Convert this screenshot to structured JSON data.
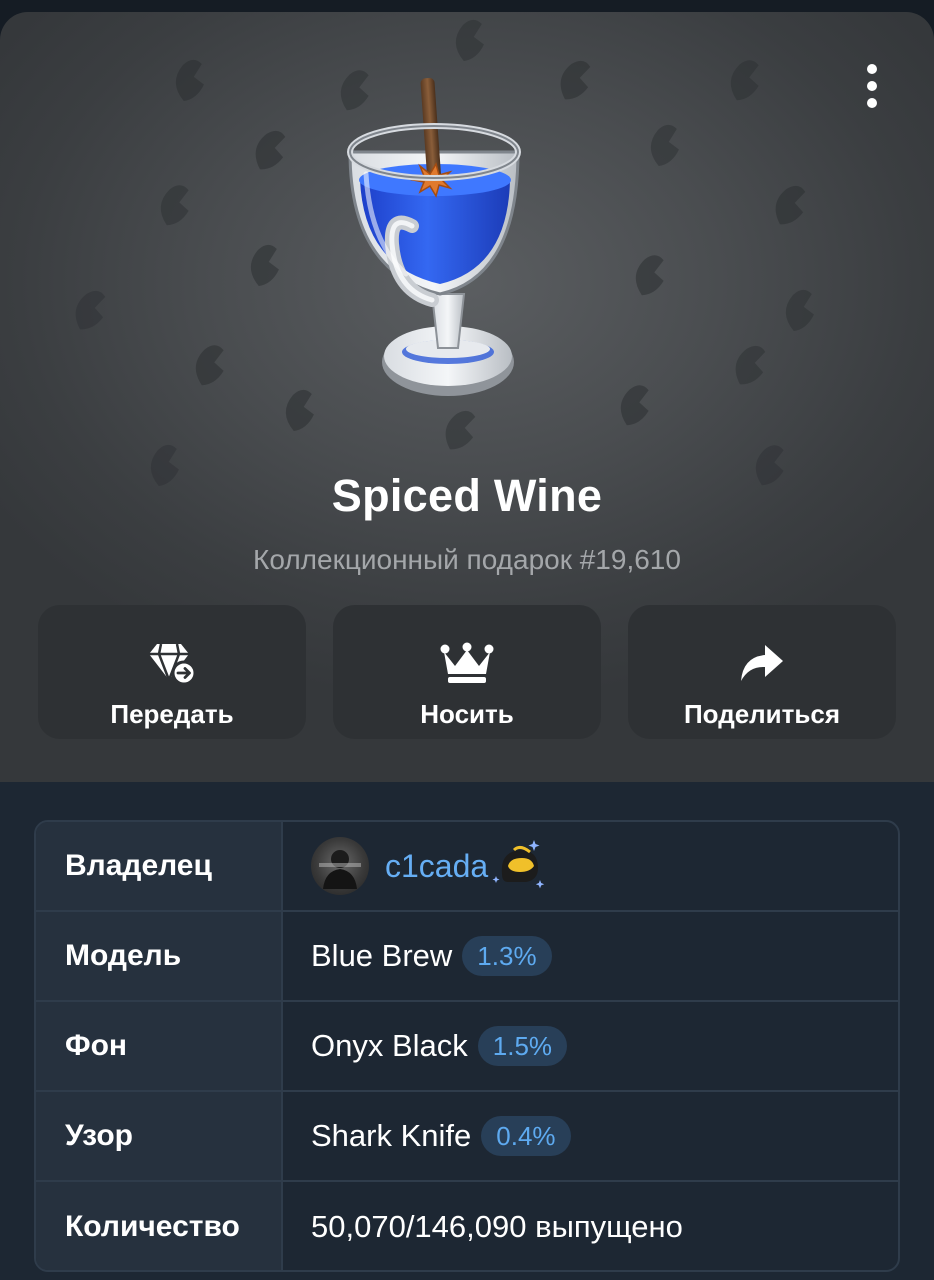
{
  "gift": {
    "title": "Spiced Wine",
    "subtitle": "Коллекционный подарок #19,610"
  },
  "actions": [
    {
      "label": "Передать",
      "icon": "diamond-transfer-icon"
    },
    {
      "label": "Носить",
      "icon": "crown-icon"
    },
    {
      "label": "Поделиться",
      "icon": "share-arrow-icon"
    }
  ],
  "menu": {
    "icon": "more-vertical-icon"
  },
  "details": {
    "owner": {
      "key": "Владелец",
      "name": "c1cada",
      "avatar_icon": "user-avatar",
      "status_icon": "helmet-emoji-status-icon"
    },
    "model": {
      "key": "Модель",
      "value": "Blue Brew",
      "rarity": "1.3%"
    },
    "backdrop": {
      "key": "Фон",
      "value": "Onyx Black",
      "rarity": "1.5%"
    },
    "pattern": {
      "key": "Узор",
      "value": "Shark Knife",
      "rarity": "0.4%"
    },
    "quantity": {
      "key": "Количество",
      "value": "50,070/146,090 выпущено"
    }
  },
  "colors": {
    "page_bg": "#1d2733",
    "hero_bg": "#4a4d50",
    "button_bg": "#2e3134",
    "badge_bg": "#283f58",
    "accent_blue": "#5eaaf0",
    "liquid_blue": "#2f5fe6"
  }
}
